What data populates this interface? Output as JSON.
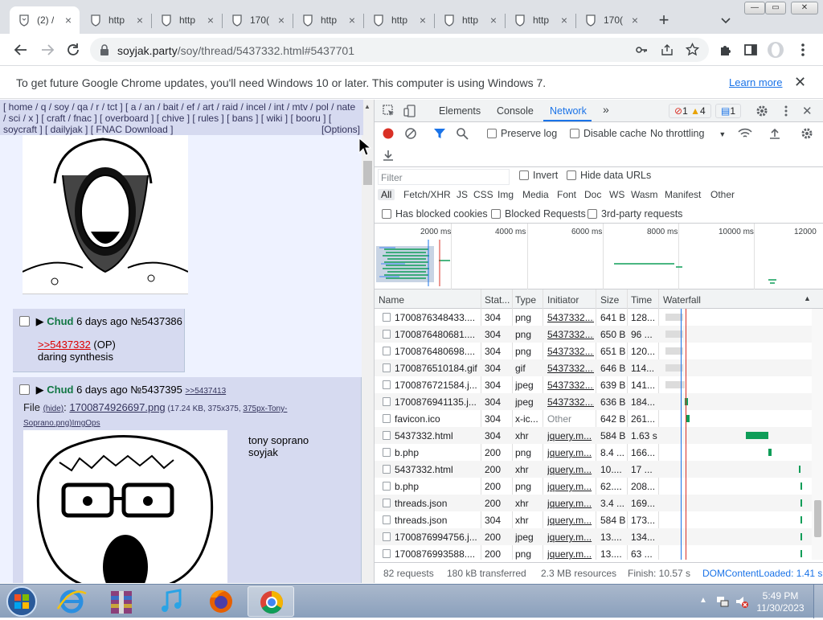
{
  "browser": {
    "tabs": [
      {
        "title": "(2) /",
        "active": true
      },
      {
        "title": "http"
      },
      {
        "title": "http"
      },
      {
        "title": "170("
      },
      {
        "title": "http"
      },
      {
        "title": "http"
      },
      {
        "title": "http"
      },
      {
        "title": "http"
      },
      {
        "title": "170("
      }
    ],
    "new_tab": "+",
    "url_host": "soyjak.party",
    "url_path": "/soy/thread/5437332.html#5437701"
  },
  "infobar": {
    "text": "To get future Google Chrome updates, you'll need Windows 10 or later. This computer is using Windows 7.",
    "link": "Learn more",
    "close": "✕"
  },
  "page": {
    "boardnav": "[ home / q / soy / qa / r / tct ] [ a / an / bait / ef / art / raid / incel / int / mtv / pol / nate / sci / x ] [ craft / fnac ] [ overboard ] [ chive ] [ rules ] [ bans ] [ wiki ] [ booru ] [ soycraft ] [ dailyjak ] [ FNAC Download ]",
    "options": "[Options]",
    "posts": [
      {
        "name": "Chud",
        "time": "6 days ago",
        "no": "№5437386",
        "quote": ">>5437332",
        "op": " (OP)",
        "body": "daring synthesis"
      },
      {
        "name": "Chud",
        "time": "6 days ago",
        "no": "№5437395",
        "backlink": ">>5437413",
        "file_label": "File ",
        "hide": "(hide)",
        "file_link": "1700874926697.png",
        "file_meta": " (17.24 KB, 375x375, ",
        "file_orig": "375px-Tony-Soprano.png)",
        "imgops": "ImgOps",
        "body_line1": "tony soprano",
        "body_line2": "soyjak"
      }
    ]
  },
  "devtools": {
    "tabs": [
      "Elements",
      "Console",
      "Network",
      "»"
    ],
    "active_tab": "Network",
    "errors": "1",
    "warnings": "4",
    "messages": "1",
    "preserve_log": "Preserve log",
    "disable_cache": "Disable cache",
    "throttling": "No throttling",
    "filter_placeholder": "Filter",
    "invert": "Invert",
    "hide_data_urls": "Hide data URLs",
    "types": [
      "All",
      "Fetch/XHR",
      "JS",
      "CSS",
      "Img",
      "Media",
      "Font",
      "Doc",
      "WS",
      "Wasm",
      "Manifest",
      "Other"
    ],
    "has_blocked_cookies": "Has blocked cookies",
    "blocked_requests": "Blocked Requests",
    "third_party": "3rd-party requests",
    "ticks": [
      "2000 ms",
      "4000 ms",
      "6000 ms",
      "8000 ms",
      "10000 ms",
      "12000"
    ],
    "columns": [
      "Name",
      "Stat...",
      "Type",
      "Initiator",
      "Size",
      "Time",
      "Waterfall"
    ],
    "rows": [
      {
        "name": "1700876348433....",
        "status": "304",
        "type": "png",
        "initiator": "5437332....",
        "size": "641 B",
        "time": "128..."
      },
      {
        "name": "1700876480681....",
        "status": "304",
        "type": "png",
        "initiator": "5437332....",
        "size": "650 B",
        "time": "96 ..."
      },
      {
        "name": "1700876480698....",
        "status": "304",
        "type": "png",
        "initiator": "5437332....",
        "size": "651 B",
        "time": "120..."
      },
      {
        "name": "1700876510184.gif",
        "status": "304",
        "type": "gif",
        "initiator": "5437332....",
        "size": "646 B",
        "time": "114..."
      },
      {
        "name": "1700876721584.j...",
        "status": "304",
        "type": "jpeg",
        "initiator": "5437332....",
        "size": "639 B",
        "time": "141..."
      },
      {
        "name": "1700876941135.j...",
        "status": "304",
        "type": "jpeg",
        "initiator": "5437332....",
        "size": "636 B",
        "time": "184..."
      },
      {
        "name": "favicon.ico",
        "status": "304",
        "type": "x-ic...",
        "initiator": "Other",
        "size": "642 B",
        "time": "261..."
      },
      {
        "name": "5437332.html",
        "status": "304",
        "type": "xhr",
        "initiator": "jquery.m...",
        "size": "584 B",
        "time": "1.63 s"
      },
      {
        "name": "b.php",
        "status": "200",
        "type": "png",
        "initiator": "jquery.m...",
        "size": "8.4 ...",
        "time": "166..."
      },
      {
        "name": "5437332.html",
        "status": "200",
        "type": "xhr",
        "initiator": "jquery.m...",
        "size": "10....",
        "time": "17 ..."
      },
      {
        "name": "b.php",
        "status": "200",
        "type": "png",
        "initiator": "jquery.m...",
        "size": "62....",
        "time": "208..."
      },
      {
        "name": "threads.json",
        "status": "200",
        "type": "xhr",
        "initiator": "jquery.m...",
        "size": "3.4 ...",
        "time": "169..."
      },
      {
        "name": "threads.json",
        "status": "304",
        "type": "xhr",
        "initiator": "jquery.m...",
        "size": "584 B",
        "time": "173..."
      },
      {
        "name": "1700876994756.j...",
        "status": "200",
        "type": "jpeg",
        "initiator": "jquery.m...",
        "size": "13....",
        "time": "134..."
      },
      {
        "name": "1700876993588....",
        "status": "200",
        "type": "png",
        "initiator": "jquery.m...",
        "size": "13....",
        "time": "63 ..."
      }
    ],
    "status": {
      "requests": "82 requests",
      "transferred": "180 kB transferred",
      "resources": "2.3 MB resources",
      "finish": "Finish: 10.57 s",
      "dcl": "DOMContentLoaded: 1.41 s"
    }
  },
  "taskbar": {
    "time": "5:49 PM",
    "date": "11/30/2023"
  },
  "colors": {
    "accent": "#1a73e8",
    "post_name": "#117743",
    "quote": "#dd0000",
    "waterfall_green": "#0f9d58"
  }
}
